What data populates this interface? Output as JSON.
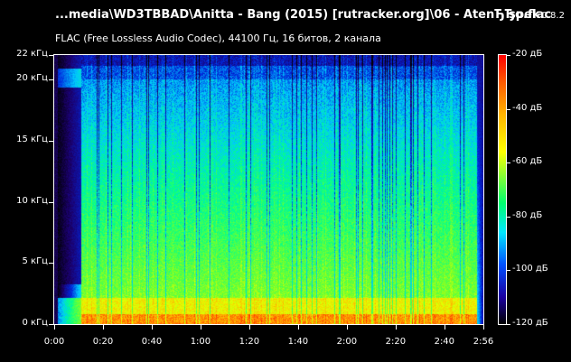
{
  "window": {
    "title": "...media\\WD3TBBAD\\Anitta - Bang (2015) [rutracker.org]\\06 - AtenЂЂo.flac",
    "app_name": "spek",
    "app_version": "0.8.2",
    "subtitle": "FLAC (Free Lossless Audio Codec), 44100 Гц, 16 битов, 2 канала"
  },
  "spectrogram": {
    "y_axis": {
      "ticks": [
        "22 кГц",
        "20 кГц",
        "15 кГц",
        "10 кГц",
        "5 кГц",
        "0 кГц"
      ],
      "values_khz": [
        22,
        20,
        15,
        10,
        5,
        0
      ],
      "range_khz": [
        0,
        22
      ]
    },
    "x_axis": {
      "ticks": [
        "0:00",
        "0:20",
        "0:40",
        "1:00",
        "1:20",
        "1:40",
        "2:00",
        "2:20",
        "2:40",
        "2:56"
      ],
      "values_sec": [
        0,
        20,
        40,
        60,
        80,
        100,
        120,
        140,
        160,
        176
      ],
      "range_sec": [
        0,
        176
      ]
    },
    "legend": {
      "ticks": [
        "-20 дБ",
        "-40 дБ",
        "-60 дБ",
        "-80 дБ",
        "-100 дБ",
        "-120 дБ"
      ],
      "values_db": [
        -20,
        -40,
        -60,
        -80,
        -100,
        -120
      ],
      "range_db": [
        -120,
        -20
      ]
    },
    "colors": {
      "background": "#000000",
      "text": "#ffffff"
    }
  }
}
